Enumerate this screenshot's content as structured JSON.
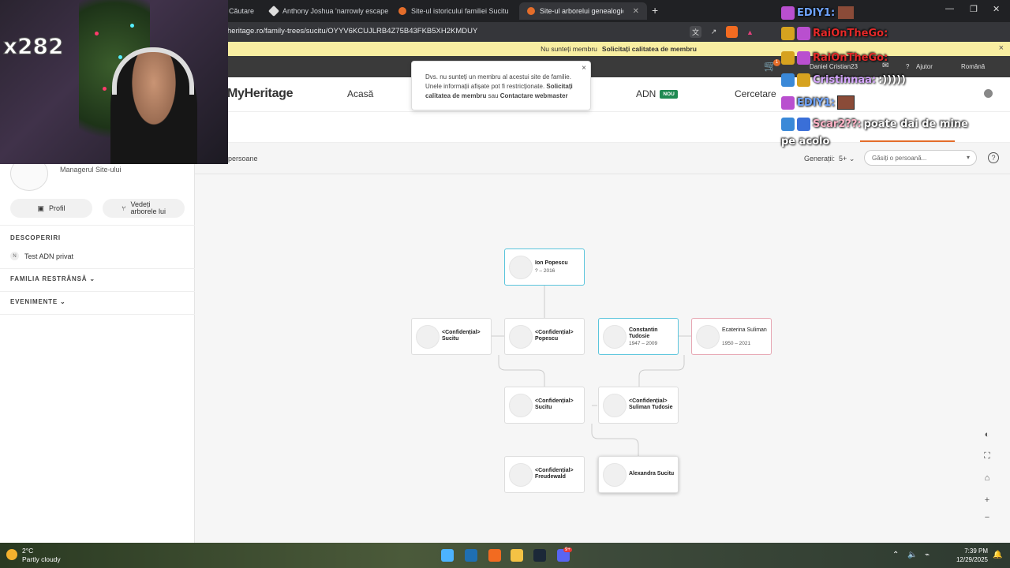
{
  "browser": {
    "tabs": [
      {
        "label": "Căutare"
      },
      {
        "label": "Anthony Joshua 'narrowly escapes de"
      },
      {
        "label": "Site-ul istoricului familiei Sucitu"
      },
      {
        "label": "Site-ul arborelui genealogic per"
      }
    ],
    "new_tab": "+",
    "url": "heritage.ro/family-trees/sucitu/OYYV6KCUJLRB4Z75B43FKB5XH2KMDUY"
  },
  "notice": {
    "text": "Nu sunteți membru",
    "link": "Solicitați calitatea de membru",
    "close": "×"
  },
  "topstrip": {
    "user": "Daniel Cristian23",
    "help": "Ajutor",
    "language": "Română",
    "cart_badge": "1"
  },
  "nav": {
    "logo": "MyHeritage",
    "home": "Acasă",
    "dna": "ADN",
    "dna_badge": "NOU",
    "research": "Cercetare"
  },
  "tooltip": {
    "line1": "Dvs. nu sunteți un membru al acestui site de familie.",
    "line2": "Unele informații afișate pot fi restricționate.",
    "link1": "Solicitați",
    "link1b": "calitatea de membru",
    "or": "sau",
    "link2": "Contactare webmaster",
    "close": "×"
  },
  "toolbar": {
    "persons": "persoane",
    "generations_label": "Generații:",
    "generations_value": "5+",
    "search_placeholder": "Găsiți o persoană...",
    "help": "?"
  },
  "sidebar": {
    "manager": "Managerul Site-ului",
    "profile_btn": "Profil",
    "tree_btn_line1": "Vedeți",
    "tree_btn_line2": "arborele lui",
    "discoveries": "DESCOPERIRI",
    "dna_test_badge": "N",
    "dna_test": "Test ADN privat",
    "family": "FAMILIA RESTRÂNSĂ",
    "events": "EVENIMENTE"
  },
  "tree": {
    "people": [
      {
        "name": "Ion Popescu",
        "years": "? – 2016"
      },
      {
        "name": "<Confidențial> Sucitu",
        "years": ""
      },
      {
        "name": "<Confidențial> Popescu",
        "years": ""
      },
      {
        "name": "Constantin Tudosie",
        "years": "1947 – 2009"
      },
      {
        "name": "Ecaterina Suliman",
        "years": "1950 – 2021"
      },
      {
        "name": "<Confidențial> Sucitu",
        "years": ""
      },
      {
        "name": "<Confidențial> Suliman Tudosie",
        "years": ""
      },
      {
        "name": "<Confidențial> Freudewald",
        "years": ""
      },
      {
        "name": "Alexandra Sucitu",
        "years": ""
      }
    ],
    "zoom_in": "+",
    "zoom_out": "−"
  },
  "stream": {
    "counter": "x282",
    "chat": [
      {
        "user": "EDIY1:",
        "text": ""
      },
      {
        "user": "RaiOnTheGo:",
        "text": ""
      },
      {
        "user": "RaiOnTheGo:",
        "text": ""
      },
      {
        "user": "Cristinnaa:",
        "text": ":)))))"
      },
      {
        "user": "EDIY1:",
        "text": ""
      },
      {
        "user": "Scar2??:",
        "text": "poate dai de mine"
      },
      {
        "user": "",
        "text": "pe acolo"
      }
    ]
  },
  "taskbar": {
    "temp": "2°C",
    "weather": "Partly cloudy",
    "time": "7:39 PM",
    "date": "12/29/2025",
    "discord_badge": "9+"
  },
  "colors": {
    "blue_card": "#5bc5dc",
    "pink_card": "#e7a7b3",
    "notice_bg": "#f8eea1",
    "dna_badge": "#1f8a52"
  }
}
